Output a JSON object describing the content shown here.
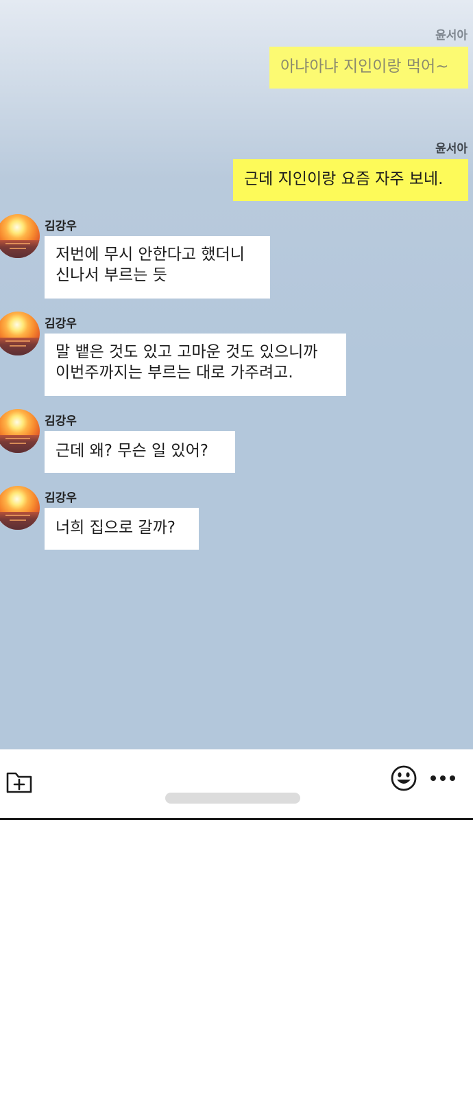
{
  "messages": [
    {
      "sender": "윤서아",
      "direction": "outgoing",
      "text": "아냐아냐 지인이랑 먹어~"
    },
    {
      "sender": "윤서아",
      "direction": "outgoing",
      "text": "근데 지인이랑 요즘 자주 보네."
    },
    {
      "sender": "김강우",
      "direction": "incoming",
      "lines": [
        "저번에 무시 안한다고 했더니",
        "신나서 부르는 듯"
      ]
    },
    {
      "sender": "김강우",
      "direction": "incoming",
      "lines": [
        "말 뱉은 것도 있고 고마운 것도 있으니까",
        "이번주까지는 부르는 대로 가주려고."
      ]
    },
    {
      "sender": "김강우",
      "direction": "incoming",
      "text": "근데 왜?  무슨 일 있어?"
    },
    {
      "sender": "김강우",
      "direction": "incoming",
      "text": "너희 집으로 갈까?"
    }
  ],
  "toolbar": {
    "left_icon": "folder-add-icon",
    "right_icons": [
      "emoji-icon",
      "more-icon"
    ]
  },
  "colors": {
    "outgoing_bubble": "#fdfa59",
    "incoming_bubble": "#ffffff",
    "chat_background": "#b3c7db"
  }
}
